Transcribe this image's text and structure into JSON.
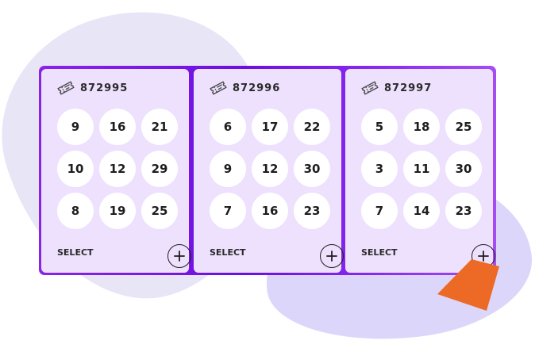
{
  "tickets": [
    {
      "id": "872995",
      "numbers": [
        "9",
        "16",
        "21",
        "10",
        "12",
        "29",
        "8",
        "19",
        "25"
      ],
      "select_label": "SELECT"
    },
    {
      "id": "872996",
      "numbers": [
        "6",
        "17",
        "22",
        "9",
        "12",
        "30",
        "7",
        "16",
        "23"
      ],
      "select_label": "SELECT"
    },
    {
      "id": "872997",
      "numbers": [
        "5",
        "18",
        "25",
        "3",
        "11",
        "30",
        "7",
        "14",
        "23"
      ],
      "select_label": "SELECT"
    }
  ],
  "icons": {
    "ticket": "ticket-icon",
    "add": "plus-circle-icon"
  },
  "colors": {
    "accent": "#7a17e6",
    "card": "#ede1fd",
    "highlight": "#ec6a26"
  }
}
